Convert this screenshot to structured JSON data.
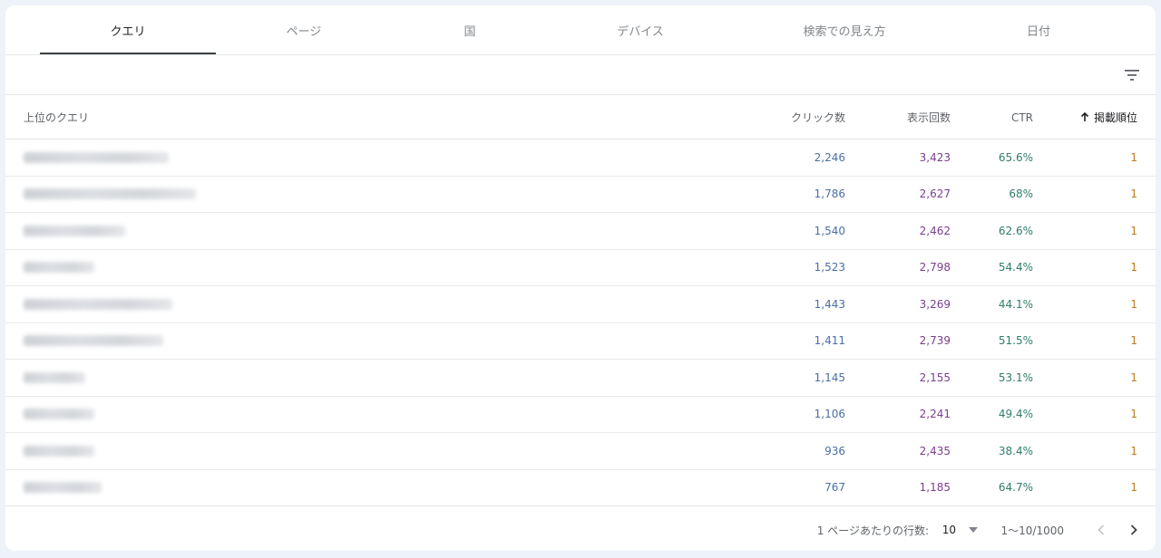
{
  "tabs": [
    {
      "label": "クエリ",
      "active": true
    },
    {
      "label": "ページ",
      "active": false
    },
    {
      "label": "国",
      "active": false
    },
    {
      "label": "デバイス",
      "active": false
    },
    {
      "label": "検索での見え方",
      "active": false
    },
    {
      "label": "日付",
      "active": false
    }
  ],
  "table": {
    "headers": {
      "query": "上位のクエリ",
      "clicks": "クリック数",
      "impressions": "表示回数",
      "ctr": "CTR",
      "position": "掲載順位"
    },
    "sort_icon": "arrow-up-icon",
    "rows": [
      {
        "query": "",
        "clicks": "2,246",
        "impressions": "3,423",
        "ctr": "65.6%",
        "position": "1"
      },
      {
        "query": "",
        "clicks": "1,786",
        "impressions": "2,627",
        "ctr": "68%",
        "position": "1"
      },
      {
        "query": "",
        "clicks": "1,540",
        "impressions": "2,462",
        "ctr": "62.6%",
        "position": "1"
      },
      {
        "query": "",
        "clicks": "1,523",
        "impressions": "2,798",
        "ctr": "54.4%",
        "position": "1"
      },
      {
        "query": "",
        "clicks": "1,443",
        "impressions": "3,269",
        "ctr": "44.1%",
        "position": "1"
      },
      {
        "query": "",
        "clicks": "1,411",
        "impressions": "2,739",
        "ctr": "51.5%",
        "position": "1"
      },
      {
        "query": "",
        "clicks": "1,145",
        "impressions": "2,155",
        "ctr": "53.1%",
        "position": "1"
      },
      {
        "query": "",
        "clicks": "1,106",
        "impressions": "2,241",
        "ctr": "49.4%",
        "position": "1"
      },
      {
        "query": "",
        "clicks": "936",
        "impressions": "2,435",
        "ctr": "38.4%",
        "position": "1"
      },
      {
        "query": "",
        "clicks": "767",
        "impressions": "1,185",
        "ctr": "64.7%",
        "position": "1"
      }
    ]
  },
  "pagination": {
    "rows_per_page_label": "1 ページあたりの行数:",
    "rows_per_page_value": "10",
    "range": "1〜10/1000"
  },
  "colors": {
    "clicks": "#4a6fa5",
    "impressions": "#7b3f8e",
    "ctr": "#2e7d6b",
    "position": "#c07a1e"
  }
}
